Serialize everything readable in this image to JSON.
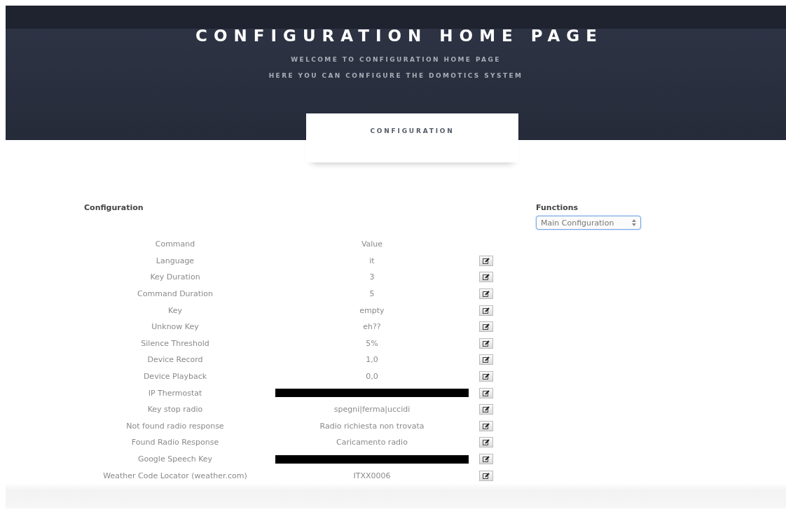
{
  "header": {
    "title": "CONFIGURATION HOME PAGE",
    "subtitle_lines": [
      "WELCOME TO CONFIGURATION HOME PAGE",
      "HERE YOU CAN CONFIGURE THE DOMOTICS SYSTEM"
    ],
    "tab": {
      "label": "CONFIGURATION",
      "selected": true
    }
  },
  "configuration": {
    "heading": "Configuration",
    "columns": [
      "Command",
      "Value"
    ],
    "rows": [
      {
        "command": "Language",
        "value": "it",
        "redacted": false
      },
      {
        "command": "Key Duration",
        "value": "3",
        "redacted": false
      },
      {
        "command": "Command Duration",
        "value": "5",
        "redacted": false
      },
      {
        "command": "Key",
        "value": "empty",
        "redacted": false
      },
      {
        "command": "Unknow Key",
        "value": "eh??",
        "redacted": false
      },
      {
        "command": "Silence Threshold",
        "value": "5%",
        "redacted": false
      },
      {
        "command": "Device Record",
        "value": "1,0",
        "redacted": false
      },
      {
        "command": "Device Playback",
        "value": "0,0",
        "redacted": false
      },
      {
        "command": "IP Thermostat",
        "redacted": true
      },
      {
        "command": "Key stop radio",
        "value": "spegni|ferma|uccidi",
        "redacted": false
      },
      {
        "command": "Not found radio response",
        "value": "Radio richiesta non trovata",
        "redacted": false
      },
      {
        "command": "Found Radio Response",
        "value": "Caricamento radio",
        "redacted": false
      },
      {
        "command": "Google Speech Key",
        "redacted": true
      },
      {
        "command": "Weather Code Locator (weather.com)",
        "value": "ITXX0006",
        "redacted": false
      }
    ]
  },
  "functions": {
    "heading": "Functions",
    "select": {
      "value": "Main Configuration"
    }
  }
}
